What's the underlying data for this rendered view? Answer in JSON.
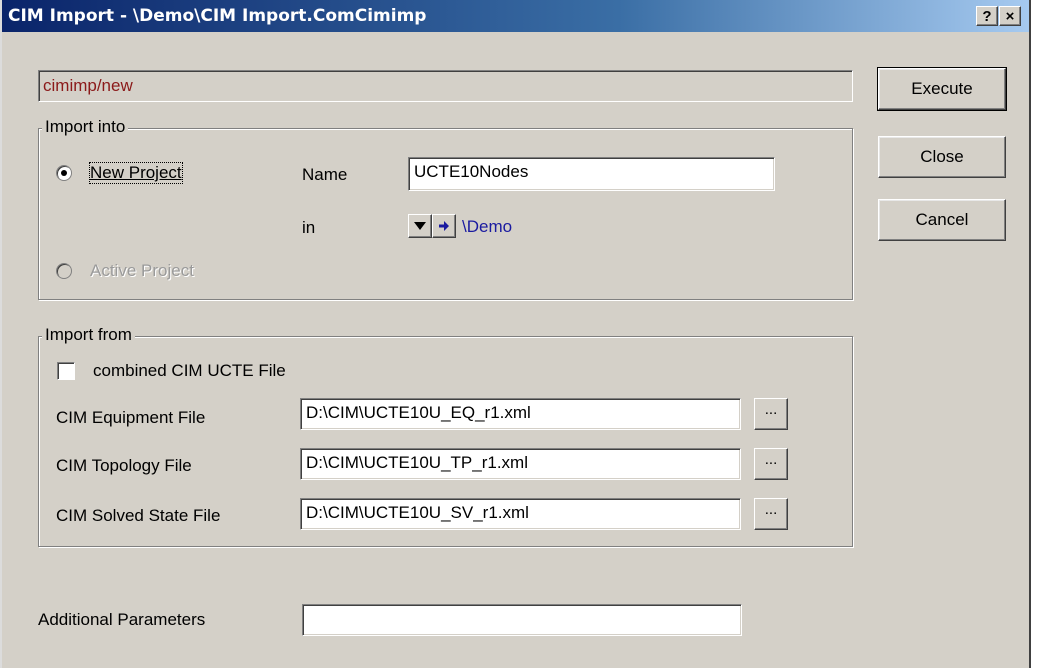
{
  "window": {
    "title": "CIM Import - \\Demo\\CIM Import.ComCimimp",
    "help_button": "?",
    "close_button": "×"
  },
  "command": "cimimp/new",
  "buttons": {
    "execute": "Execute",
    "close": "Close",
    "cancel": "Cancel"
  },
  "import_into": {
    "legend": "Import into",
    "new_project_label": "New Project",
    "new_project_selected": true,
    "name_label": "Name",
    "name_value": "UCTE10Nodes",
    "in_label": "in",
    "in_path": "\\Demo",
    "active_project_label": "Active Project",
    "active_project_enabled": false
  },
  "import_from": {
    "legend": "Import from",
    "combined_label": "combined CIM UCTE File",
    "combined_checked": false,
    "files": [
      {
        "label": "CIM Equipment File",
        "value": "D:\\CIM\\UCTE10U_EQ_r1.xml",
        "browse": "..."
      },
      {
        "label": "CIM Topology File",
        "value": "D:\\CIM\\UCTE10U_TP_r1.xml",
        "browse": "..."
      },
      {
        "label": "CIM Solved State File",
        "value": "D:\\CIM\\UCTE10U_SV_r1.xml",
        "browse": "..."
      }
    ]
  },
  "additional": {
    "label": "Additional Parameters",
    "value": ""
  },
  "icons": {
    "dropdown": "triangle-down",
    "jump": "arrow-right"
  }
}
